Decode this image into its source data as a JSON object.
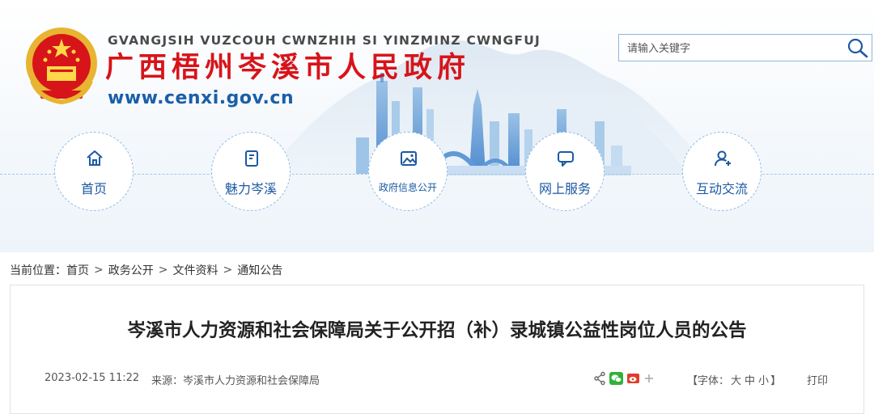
{
  "header": {
    "pinyin": "GVANGJSIH VUZCOUH CWNZHIH SI YINZMINZ CWNGFUJ",
    "title": "广西梧州岑溪市人民政府",
    "url": "www.cenxi.gov.cn"
  },
  "search": {
    "placeholder": "请输入关键字"
  },
  "nav": {
    "items": [
      {
        "label": "首页",
        "icon": "home-icon"
      },
      {
        "label": "魅力岑溪",
        "icon": "document-icon"
      },
      {
        "label": "政府信息公开",
        "icon": "image-icon"
      },
      {
        "label": "网上服务",
        "icon": "chat-icon"
      },
      {
        "label": "互动交流",
        "icon": "user-add-icon"
      }
    ]
  },
  "breadcrumb": {
    "prefix": "当前位置：",
    "items": [
      "首页",
      "政务公开",
      "文件资料",
      "通知公告"
    ],
    "separator": ">"
  },
  "article": {
    "title": "岑溪市人力资源和社会保障局关于公开招（补）录城镇公益性岗位人员的公告",
    "date": "2023-02-15 11:22",
    "source": "来源：岑溪市人力资源和社会保障局",
    "font_label_prefix": "【字体：",
    "font_sizes": [
      "大",
      "中",
      "小"
    ],
    "font_label_suffix": "】",
    "print_label": "打印"
  },
  "colors": {
    "brand_red": "#d7141a",
    "brand_blue": "#1c5aa3",
    "accent_light_blue": "#8fbbe3"
  }
}
